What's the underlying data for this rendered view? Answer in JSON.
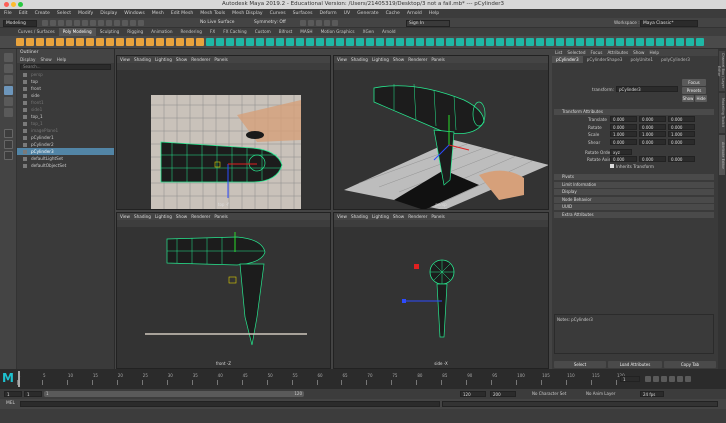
{
  "window": {
    "title": "Autodesk Maya 2019.2 - Educational Version: /Users/21405319/Desktop/3 not a fail.mb* --- pCylinder3",
    "workspace_label": "Workspace :",
    "workspace_value": "Maya Classic*"
  },
  "menubar": [
    "File",
    "Edit",
    "Create",
    "Select",
    "Modify",
    "Display",
    "Windows",
    "Mesh",
    "Edit Mesh",
    "Mesh Tools",
    "Mesh Display",
    "Curves",
    "Surfaces",
    "Deform",
    "UV",
    "Generate",
    "Cache",
    "Arnold",
    "Help"
  ],
  "statusline": {
    "mode": "Modeling",
    "live_surface": "No Live Surface",
    "symmetry": "Symmetry: Off",
    "sign_in": "Sign In"
  },
  "shelf_tabs": [
    "Curves / Surfaces",
    "Poly Modeling",
    "Sculpting",
    "Rigging",
    "Animation",
    "Rendering",
    "FX",
    "FX Caching",
    "Custom",
    "Bifrost",
    "MASH",
    "Motion Graphics",
    "XGen",
    "Arnold"
  ],
  "shelf_active": "Poly Modeling",
  "outliner": {
    "title": "Outliner",
    "menu": [
      "Display",
      "Show",
      "Help"
    ],
    "search_placeholder": "Search...",
    "items": [
      {
        "label": "persp",
        "state": "dim"
      },
      {
        "label": "top",
        "state": "normal"
      },
      {
        "label": "front",
        "state": "normal"
      },
      {
        "label": "side",
        "state": "normal"
      },
      {
        "label": "front1",
        "state": "dim"
      },
      {
        "label": "side1",
        "state": "dim"
      },
      {
        "label": "top_1",
        "state": "normal"
      },
      {
        "label": "top_1",
        "state": "dim"
      },
      {
        "label": "imagePlane1",
        "state": "dim"
      },
      {
        "label": "pCylinder1",
        "state": "normal"
      },
      {
        "label": "pCylinder2",
        "state": "normal"
      },
      {
        "label": "pCylinder3",
        "state": "selected"
      },
      {
        "label": "defaultLightSet",
        "state": "normal"
      },
      {
        "label": "defaultObjectSet",
        "state": "normal"
      }
    ]
  },
  "viewport_menu": [
    "View",
    "Shading",
    "Lighting",
    "Show",
    "Renderer",
    "Panels"
  ],
  "viewports": [
    {
      "camera": "top -Y"
    },
    {
      "camera": "persp"
    },
    {
      "camera": "front -Z"
    },
    {
      "camera": "side -X"
    }
  ],
  "attribute_editor": {
    "menu": [
      "List",
      "Selected",
      "Focus",
      "Attributes",
      "Show",
      "Help"
    ],
    "tabs": [
      "pCylinder3",
      "pCylinderShape3",
      "polyUnite1",
      "polyCylinder3"
    ],
    "node_label": "transform:",
    "node_value": "pCylinder3",
    "focus_btn": "Focus",
    "presets_btn": "Presets",
    "show_btn": "Show",
    "hide_btn": "Hide",
    "section_transform": "Transform Attributes",
    "rows": [
      {
        "label": "Translate",
        "values": [
          "0.000",
          "0.000",
          "0.000"
        ]
      },
      {
        "label": "Rotate",
        "values": [
          "0.000",
          "0.000",
          "0.000"
        ]
      },
      {
        "label": "Scale",
        "values": [
          "1.000",
          "1.000",
          "1.000"
        ]
      },
      {
        "label": "Shear",
        "values": [
          "0.000",
          "0.000",
          "0.000"
        ]
      }
    ],
    "rotate_order_label": "Rotate Order",
    "rotate_order_value": "xyz",
    "rotate_axis_label": "Rotate Axis",
    "rotate_axis_values": [
      "0.000",
      "0.000",
      "0.000"
    ],
    "inherits": "Inherits Transform",
    "sections": [
      "Pivots",
      "Limit Information",
      "Display",
      "Node Behavior",
      "UUID",
      "Extra Attributes"
    ],
    "notes_label": "Notes:  pCylinder3",
    "select_btn": "Select",
    "load_btn": "Load Attributes",
    "copy_btn": "Copy Tab"
  },
  "side_tabs": [
    "Channel Box / Layer Editor",
    "Modelling Toolkit",
    "Attribute Editor"
  ],
  "timeline": {
    "ticks": [
      "1",
      "5",
      "10",
      "15",
      "20",
      "25",
      "30",
      "35",
      "40",
      "45",
      "50",
      "55",
      "60",
      "65",
      "70",
      "75",
      "80",
      "85",
      "90",
      "95",
      "100",
      "105",
      "110",
      "115",
      "120"
    ],
    "current_frame": "1"
  },
  "range": {
    "start": "1",
    "inner_start": "1",
    "inner_end": "120",
    "end1": "120",
    "end2": "200",
    "character_set": "No Character Set",
    "anim_layer": "No Anim Layer",
    "fps": "24 fps"
  },
  "command_line": {
    "label": "MEL"
  }
}
